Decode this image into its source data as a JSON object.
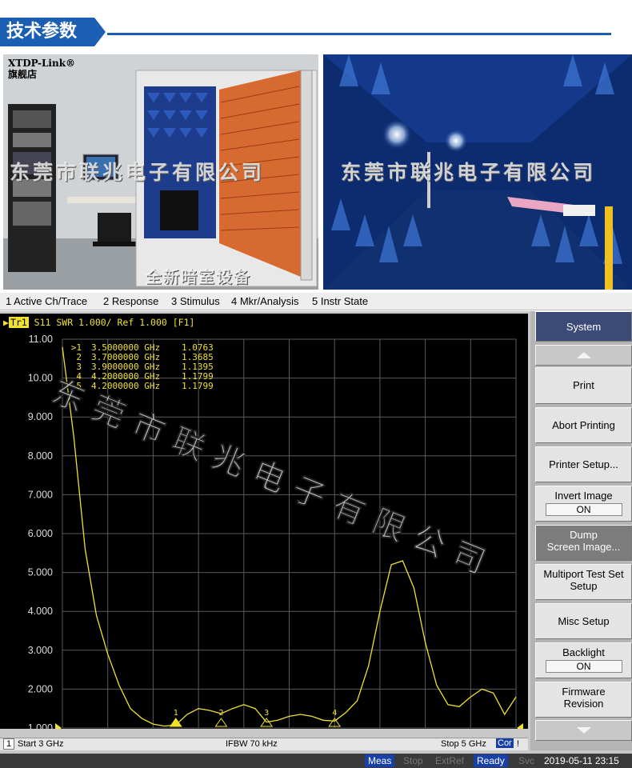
{
  "banner": {
    "title": "技术参数"
  },
  "photos": {
    "left_logo": "XTDP-Link®",
    "left_logo_sub": "旗舰店",
    "left_watermark": "东莞市联兆电子有限公司",
    "left_caption": "全新暗室设备",
    "right_watermark": "东莞市联兆电子有限公司"
  },
  "menubar": {
    "items": [
      "1 Active Ch/Trace",
      "2 Response",
      "3 Stimulus",
      "4 Mkr/Analysis",
      "5 Instr State"
    ]
  },
  "trace_header": {
    "tr": "Tr1",
    "text": "S11 SWR 1.000/ Ref 1.000 [F1]"
  },
  "markers": [
    {
      "id": ">1",
      "freq": "3.5000000 GHz",
      "value": "1.0763"
    },
    {
      "id": "2",
      "freq": "3.7000000 GHz",
      "value": "1.3685"
    },
    {
      "id": "3",
      "freq": "3.9000000 GHz",
      "value": "1.1395"
    },
    {
      "id": "4",
      "freq": "4.2000000 GHz",
      "value": "1.1799"
    },
    {
      "id": "5",
      "freq": "4.2000000 GHz",
      "value": "1.1799"
    }
  ],
  "plot_watermark": "东莞市联兆电子有限公司",
  "chart_data": {
    "type": "line",
    "xlabel": "",
    "ylabel": "",
    "xlim": [
      3.0,
      5.0
    ],
    "ylim": [
      1.0,
      11.0
    ],
    "y_ticks": [
      "11.00",
      "10.00",
      "9.000",
      "8.000",
      "7.000",
      "6.000",
      "5.000",
      "4.000",
      "3.000",
      "2.000",
      "1.000"
    ],
    "grid": true,
    "trace_color": "#f0e030",
    "series": [
      {
        "x": [
          3.0,
          3.05,
          3.1,
          3.15,
          3.2,
          3.25,
          3.3,
          3.35,
          3.4,
          3.45,
          3.5,
          3.55,
          3.6,
          3.65,
          3.7,
          3.75,
          3.8,
          3.85,
          3.9,
          3.95,
          4.0,
          4.05,
          4.1,
          4.15,
          4.2,
          4.25,
          4.3,
          4.35,
          4.4,
          4.45,
          4.5,
          4.55,
          4.6,
          4.65,
          4.7,
          4.75,
          4.8,
          4.85,
          4.9,
          4.95,
          5.0
        ],
        "y": [
          10.8,
          8.5,
          5.6,
          3.9,
          2.9,
          2.1,
          1.5,
          1.25,
          1.1,
          1.05,
          1.08,
          1.35,
          1.5,
          1.45,
          1.37,
          1.5,
          1.6,
          1.5,
          1.15,
          1.2,
          1.3,
          1.35,
          1.3,
          1.2,
          1.18,
          1.4,
          1.7,
          2.6,
          4.0,
          5.2,
          5.3,
          4.6,
          3.2,
          2.1,
          1.6,
          1.55,
          1.8,
          2.0,
          1.9,
          1.35,
          1.8
        ]
      }
    ],
    "marker_x": [
      3.5,
      3.7,
      3.9,
      4.2
    ]
  },
  "statusbar": {
    "channel": "1",
    "start": "Start 3 GHz",
    "ifbw": "IFBW 70 kHz",
    "stop": "Stop 5 GHz",
    "cor": "Cor",
    "excl": "!"
  },
  "bottombar": {
    "meas": "Meas",
    "stop": "Stop",
    "extref": "ExtRef",
    "ready": "Ready",
    "svc": "Svc",
    "datetime": "2019-05-11 23:15"
  },
  "softkeys": {
    "title": "System",
    "print": "Print",
    "abort": "Abort Printing",
    "printer": "Printer Setup...",
    "invert": "Invert Image",
    "invert_val": "ON",
    "dump1": "Dump",
    "dump2": "Screen Image...",
    "multi1": "Multiport Test Set",
    "multi2": "Setup",
    "misc": "Misc Setup",
    "backlight": "Backlight",
    "backlight_val": "ON",
    "fw1": "Firmware",
    "fw2": "Revision"
  }
}
